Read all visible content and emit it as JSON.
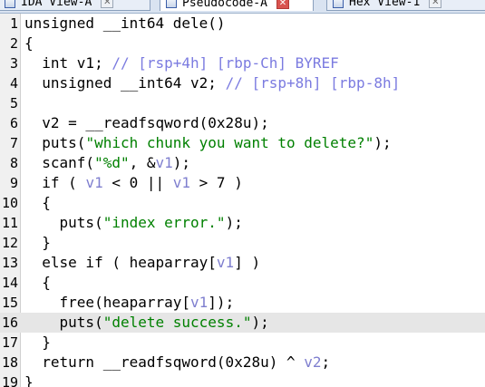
{
  "tabs": [
    {
      "label": "IDA View-A",
      "active": false
    },
    {
      "label": "Pseudocode-A",
      "active": true
    },
    {
      "label": "Hex View-1",
      "active": false
    }
  ],
  "lines": [
    {
      "n": "1",
      "parts": [
        [
          "t",
          "unsigned __int64 dele()"
        ]
      ]
    },
    {
      "n": "2",
      "parts": [
        [
          "t",
          "{"
        ]
      ]
    },
    {
      "n": "3",
      "parts": [
        [
          "t",
          "  int v1; "
        ],
        [
          "cm",
          "// [rsp+4h] [rbp-Ch] BYREF"
        ]
      ]
    },
    {
      "n": "4",
      "parts": [
        [
          "t",
          "  unsigned __int64 v2; "
        ],
        [
          "cm",
          "// [rsp+8h] [rbp-8h]"
        ]
      ]
    },
    {
      "n": "5",
      "parts": [
        [
          "t",
          ""
        ]
      ]
    },
    {
      "n": "6",
      "parts": [
        [
          "t",
          "  v2 = __readfsqword(0x28u);"
        ]
      ]
    },
    {
      "n": "7",
      "parts": [
        [
          "t",
          "  puts("
        ],
        [
          "s",
          "\"which chunk you want to delete?\""
        ],
        [
          "t",
          ");"
        ]
      ]
    },
    {
      "n": "8",
      "parts": [
        [
          "t",
          "  scanf("
        ],
        [
          "s",
          "\"%d\""
        ],
        [
          "t",
          ", &"
        ],
        [
          "fv",
          "v1"
        ],
        [
          "t",
          ");"
        ]
      ]
    },
    {
      "n": "9",
      "parts": [
        [
          "t",
          "  if ( "
        ],
        [
          "fv",
          "v1"
        ],
        [
          "t",
          " < 0 || "
        ],
        [
          "fv",
          "v1"
        ],
        [
          "t",
          " > 7 )"
        ]
      ]
    },
    {
      "n": "10",
      "parts": [
        [
          "t",
          "  {"
        ]
      ]
    },
    {
      "n": "11",
      "parts": [
        [
          "t",
          "    puts("
        ],
        [
          "s",
          "\"index error.\""
        ],
        [
          "t",
          ");"
        ]
      ]
    },
    {
      "n": "12",
      "parts": [
        [
          "t",
          "  }"
        ]
      ]
    },
    {
      "n": "13",
      "parts": [
        [
          "t",
          "  else if ( heaparray["
        ],
        [
          "fv",
          "v1"
        ],
        [
          "t",
          "] )"
        ]
      ]
    },
    {
      "n": "14",
      "parts": [
        [
          "t",
          "  {"
        ]
      ]
    },
    {
      "n": "15",
      "parts": [
        [
          "t",
          "    free(heaparray["
        ],
        [
          "fv",
          "v1"
        ],
        [
          "t",
          "]);"
        ]
      ]
    },
    {
      "n": "16",
      "parts": [
        [
          "t",
          "    puts("
        ],
        [
          "s",
          "\"delete success.\""
        ],
        [
          "t",
          ");"
        ]
      ],
      "highlight": true
    },
    {
      "n": "17",
      "parts": [
        [
          "t",
          "  }"
        ]
      ]
    },
    {
      "n": "18",
      "parts": [
        [
          "t",
          "  return __readfsqword(0x28u) ^ "
        ],
        [
          "fv",
          "v2"
        ],
        [
          "t",
          ";"
        ]
      ]
    },
    {
      "n": "19",
      "parts": [
        [
          "t",
          "}"
        ]
      ]
    }
  ]
}
